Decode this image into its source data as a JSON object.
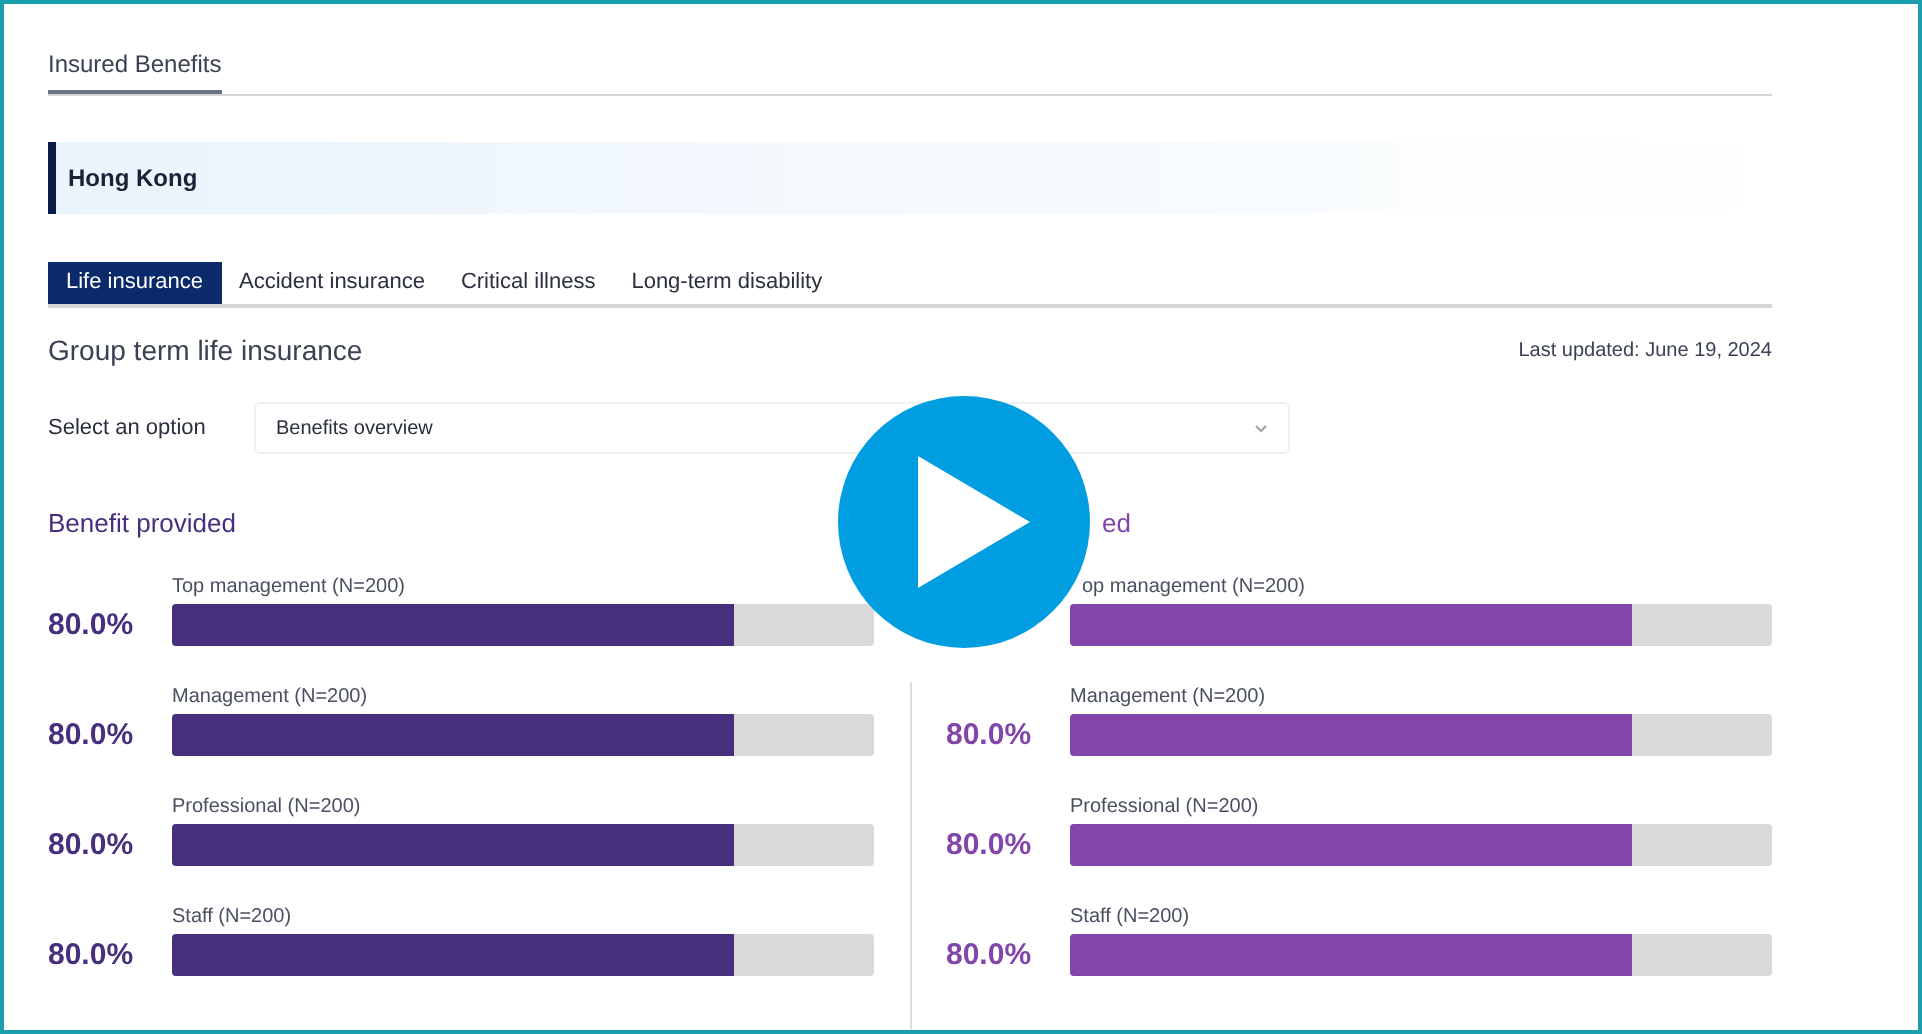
{
  "page_title": "Insured Benefits",
  "region": "Hong Kong",
  "tabs": [
    {
      "label": "Life insurance",
      "selected": true
    },
    {
      "label": "Accident insurance",
      "selected": false
    },
    {
      "label": "Critical illness",
      "selected": false
    },
    {
      "label": "Long-term disability",
      "selected": false
    }
  ],
  "section_title": "Group term life insurance",
  "last_updated": "Last updated: June 19, 2024",
  "select": {
    "label": "Select an option",
    "value": "Benefits overview"
  },
  "panels": [
    {
      "title": "Benefit provided",
      "color": "#46307e",
      "rows": [
        {
          "label": "Top management (N=200)",
          "value": "80.0%",
          "level": 0.8
        },
        {
          "label": "Management (N=200)",
          "value": "80.0%",
          "level": 0.8
        },
        {
          "label": "Professional (N=200)",
          "value": "80.0%",
          "level": 0.8
        },
        {
          "label": "Staff (N=200)",
          "value": "80.0%",
          "level": 0.8
        }
      ]
    },
    {
      "title": "ed",
      "color": "#8246aa",
      "rows": [
        {
          "label": "op management (N=200)",
          "level": 0.8
        },
        {
          "label": "Management (N=200)",
          "value": "80.0%",
          "level": 0.8
        },
        {
          "label": "Professional (N=200)",
          "value": "80.0%",
          "level": 0.8
        },
        {
          "label": "Staff (N=200)",
          "value": "80.0%",
          "level": 0.8
        }
      ]
    }
  ],
  "player": {
    "play_button": true
  }
}
